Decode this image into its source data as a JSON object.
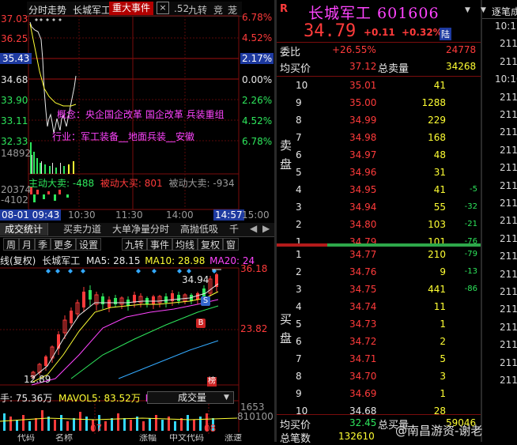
{
  "intraday": {
    "tabs": [
      "分时走势",
      "长城军工",
      "重大事件",
      ".52",
      "九转",
      "竞",
      "茏"
    ],
    "price_labels": [
      "37.03",
      "36.25",
      "35.43",
      "34.68",
      "33.90",
      "33.11",
      "32.33"
    ],
    "pct_labels": [
      "6.78%",
      "4.52%",
      "2.17%",
      "0.00%",
      "2.26%",
      "4.52%",
      "6.78%"
    ],
    "volume_label": "14892",
    "concept": "概念：央企国企改革  国企改革  兵装重组",
    "industry": "行业：军工装备__地面兵装__安徽",
    "flow": {
      "main_sell": "主动大卖: -488",
      "passive_buy": "被动大买: 801",
      "passive_sell": "被动大卖: -934"
    },
    "flow_axis": [
      "20374",
      "-4102"
    ],
    "time_labels": [
      "08-01 09:43",
      "10:30",
      "11:30",
      "14:00",
      "14:57",
      "15:00"
    ]
  },
  "tabs_row1": [
    "成交统计",
    "买卖力道",
    "大单净量分时",
    "高抛低吸",
    "千"
  ],
  "toolbar": [
    "周",
    "月",
    "季",
    "更多",
    "设置",
    "九转",
    "事件",
    "均线",
    "复权",
    "窗"
  ],
  "kline": {
    "prefix": "线(复权)",
    "name": "长城军工",
    "ma5": "MA5: 28.15",
    "ma10": "MA10: 28.98",
    "ma20": "MA20: 24",
    "axis": [
      "36.18",
      "23.82",
      "1653",
      "810100"
    ],
    "peak": "34.94",
    "low": "12.89",
    "sell_marker": "S",
    "buy_marker": "B",
    "bang": "榜",
    "vol_label": "手: 75.36万",
    "mavol5": "MAVOL5: 83.52万",
    "ma_cut": "MA",
    "select": "成交量",
    "month_labels": [
      "07",
      "08"
    ]
  },
  "quote": {
    "logo": "R",
    "title": "长城军工 601606",
    "price": "34.79",
    "change": "+0.11",
    "change_pct": "+0.32%",
    "tag": "陆",
    "weibi_label": "委比",
    "weibi": "+26.55%",
    "weicha": "24778",
    "avg_label": "均买价",
    "avg": "37.12",
    "total_sell_label": "总卖量",
    "total_sell": "34268",
    "sell_side": "卖盘",
    "buy_side": "买盘",
    "asks": [
      {
        "lvl": "10",
        "price": "35.01",
        "vol": "41",
        "chg": ""
      },
      {
        "lvl": "9",
        "price": "35.00",
        "vol": "1288",
        "chg": ""
      },
      {
        "lvl": "8",
        "price": "34.99",
        "vol": "229",
        "chg": ""
      },
      {
        "lvl": "7",
        "price": "34.98",
        "vol": "168",
        "chg": ""
      },
      {
        "lvl": "6",
        "price": "34.97",
        "vol": "48",
        "chg": ""
      },
      {
        "lvl": "5",
        "price": "34.96",
        "vol": "31",
        "chg": ""
      },
      {
        "lvl": "4",
        "price": "34.95",
        "vol": "41",
        "chg": "-5"
      },
      {
        "lvl": "3",
        "price": "34.94",
        "vol": "55",
        "chg": "-32"
      },
      {
        "lvl": "2",
        "price": "34.80",
        "vol": "103",
        "chg": "-21"
      },
      {
        "lvl": "1",
        "price": "34.79",
        "vol": "101",
        "chg": "-76"
      }
    ],
    "bids": [
      {
        "lvl": "1",
        "price": "34.77",
        "vol": "210",
        "chg": "-79"
      },
      {
        "lvl": "2",
        "price": "34.76",
        "vol": "9",
        "chg": "-13"
      },
      {
        "lvl": "3",
        "price": "34.75",
        "vol": "441",
        "chg": "-86"
      },
      {
        "lvl": "4",
        "price": "34.74",
        "vol": "11",
        "chg": ""
      },
      {
        "lvl": "5",
        "price": "34.73",
        "vol": "1",
        "chg": ""
      },
      {
        "lvl": "6",
        "price": "34.72",
        "vol": "2",
        "chg": ""
      },
      {
        "lvl": "7",
        "price": "34.71",
        "vol": "5",
        "chg": ""
      },
      {
        "lvl": "8",
        "price": "34.70",
        "vol": "3",
        "chg": ""
      },
      {
        "lvl": "9",
        "price": "34.69",
        "vol": "1",
        "chg": ""
      },
      {
        "lvl": "10",
        "price": "34.68",
        "vol": "28",
        "chg": ""
      }
    ],
    "avg_buy_label": "均买价",
    "avg_buy": "32.45",
    "total_buy_label": "总买量",
    "total_buy": "59046",
    "bottom_label": "总笔数",
    "bottom_value": "132610"
  },
  "ticks": {
    "title": "逐笔成",
    "times": [
      "10:11",
      "211",
      "211",
      "10:10",
      "211",
      "211",
      "211",
      "211",
      "211",
      "211",
      "211",
      "211",
      "211",
      "211",
      "211",
      "211",
      "211",
      "211",
      "211",
      "211",
      "211"
    ]
  },
  "bottom_cols": [
    "代码",
    "名称",
    "涨幅",
    "中文代码",
    "涨速"
  ],
  "watermark": "@南昌游资-谢老",
  "colors": {
    "up": "#ff3b3b",
    "down": "#2ee65c",
    "bg": "#000000",
    "accent": "#ffff33"
  }
}
